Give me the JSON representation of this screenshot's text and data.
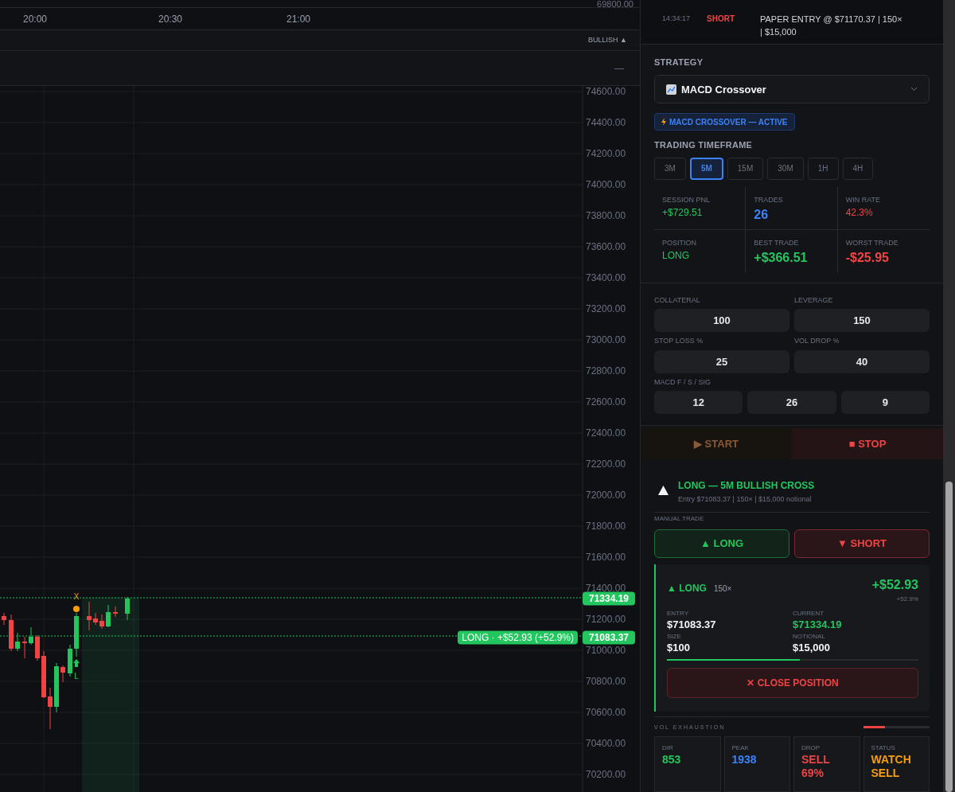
{
  "chart": {
    "top_axis_label": "69800.00",
    "time_labels": [
      "20:00",
      "20:30",
      "21:00"
    ],
    "trend_label": "BULLISH ▲",
    "panel_toggle": "—",
    "price_ticks": [
      "74600.00",
      "74400.00",
      "74200.00",
      "74000.00",
      "73800.00",
      "73600.00",
      "73400.00",
      "73200.00",
      "73000.00",
      "72800.00",
      "72600.00",
      "72400.00",
      "72200.00",
      "72000.00",
      "71800.00",
      "71600.00",
      "71400.00",
      "71200.00",
      "71000.00",
      "70800.00",
      "70600.00",
      "70400.00",
      "70200.00"
    ],
    "markers": [
      {
        "kind": "exit",
        "text": "X"
      },
      {
        "kind": "entry",
        "text": "L"
      }
    ],
    "price_tags": [
      {
        "kind": "current",
        "text": "71334.19"
      },
      {
        "kind": "entry",
        "text": "71083.37"
      }
    ],
    "position_label": "LONG · +$52.93 (+52.9%)"
  },
  "log": [
    {
      "time": "14:34:17",
      "type": "SHORT",
      "message": "PAPER ENTRY @ $71170.37 | 150× | $15,000",
      "color": "#ef4444"
    }
  ],
  "strategy": {
    "heading": "STRATEGY",
    "selected": "MACD Crossover",
    "badge": "MACD CROSSOVER — ACTIVE",
    "timeframe_heading": "TRADING TIMEFRAME",
    "timeframes": [
      {
        "label": "3M",
        "selected": false
      },
      {
        "label": "5M",
        "selected": true
      },
      {
        "label": "15M",
        "selected": false
      },
      {
        "label": "30M",
        "selected": false
      },
      {
        "label": "1H",
        "selected": false
      },
      {
        "label": "4H",
        "selected": false
      }
    ],
    "stats": [
      {
        "label": "SESSION PNL",
        "value": "+$729.51",
        "color": "#22c55e",
        "emphasized": false
      },
      {
        "label": "TRADES",
        "value": "26",
        "color": "#3b82f6",
        "emphasized": true
      },
      {
        "label": "WIN RATE",
        "value": "42.3%",
        "color": "#ef4444",
        "emphasized": false
      },
      {
        "label": "POSITION",
        "value": "LONG",
        "color": "#22c55e",
        "emphasized": false
      },
      {
        "label": "BEST TRADE",
        "value": "+$366.51",
        "color": "#22c55e",
        "emphasized": true
      },
      {
        "label": "WORST TRADE",
        "value": "-$25.95",
        "color": "#ef4444",
        "emphasized": true
      }
    ]
  },
  "params": [
    {
      "label": "COLLATERAL",
      "values": [
        "100"
      ]
    },
    {
      "label": "LEVERAGE",
      "values": [
        "150"
      ]
    },
    {
      "label": "STOP LOSS %",
      "values": [
        "25"
      ]
    },
    {
      "label": "VOL DROP %",
      "values": [
        "40"
      ]
    },
    {
      "label": "MACD F / S / SIG",
      "values": [
        "12",
        "26",
        "9"
      ]
    }
  ],
  "controls": [
    {
      "label": "▶ START",
      "disabled": true,
      "kind": "start"
    },
    {
      "label": "■ STOP",
      "disabled": false,
      "kind": "stop"
    }
  ],
  "signal": {
    "title": "LONG — 5M BULLISH CROSS",
    "detail": "Entry $71083.37 | 150× | $15,000 notional"
  },
  "manual_trade": {
    "heading": "MANUAL TRADE",
    "buttons": [
      {
        "label": "▲ LONG",
        "kind": "long"
      },
      {
        "label": "▼ SHORT",
        "kind": "short"
      }
    ]
  },
  "position": {
    "side": "▲ LONG",
    "leverage": "150×",
    "pnl": "+$52.93",
    "pnl_pct": "+52.9%",
    "fields": [
      {
        "label": "ENTRY",
        "value": "$71083.37",
        "color": "#f3f4f6"
      },
      {
        "label": "CURRENT",
        "value": "$71334.19",
        "color": "#22c55e"
      },
      {
        "label": "SIZE",
        "value": "$100",
        "color": "#f3f4f6"
      },
      {
        "label": "NOTIONAL",
        "value": "$15,000",
        "color": "#f3f4f6"
      }
    ],
    "level": 0.53,
    "close_button": "✕ CLOSE POSITION"
  },
  "vol_exhaustion": {
    "heading": "VOL EXHAUSTION",
    "level": 0.33,
    "cards": [
      {
        "label": "DIR",
        "value": "853",
        "color": "#22c55e"
      },
      {
        "label": "PEAK",
        "value": "1938",
        "color": "#3b82f6"
      },
      {
        "label": "DROP",
        "value": "SELL 69%",
        "color": "#ef4444"
      },
      {
        "label": "STATUS",
        "value": "WATCH SELL",
        "color": "#f59e0b"
      }
    ]
  }
}
